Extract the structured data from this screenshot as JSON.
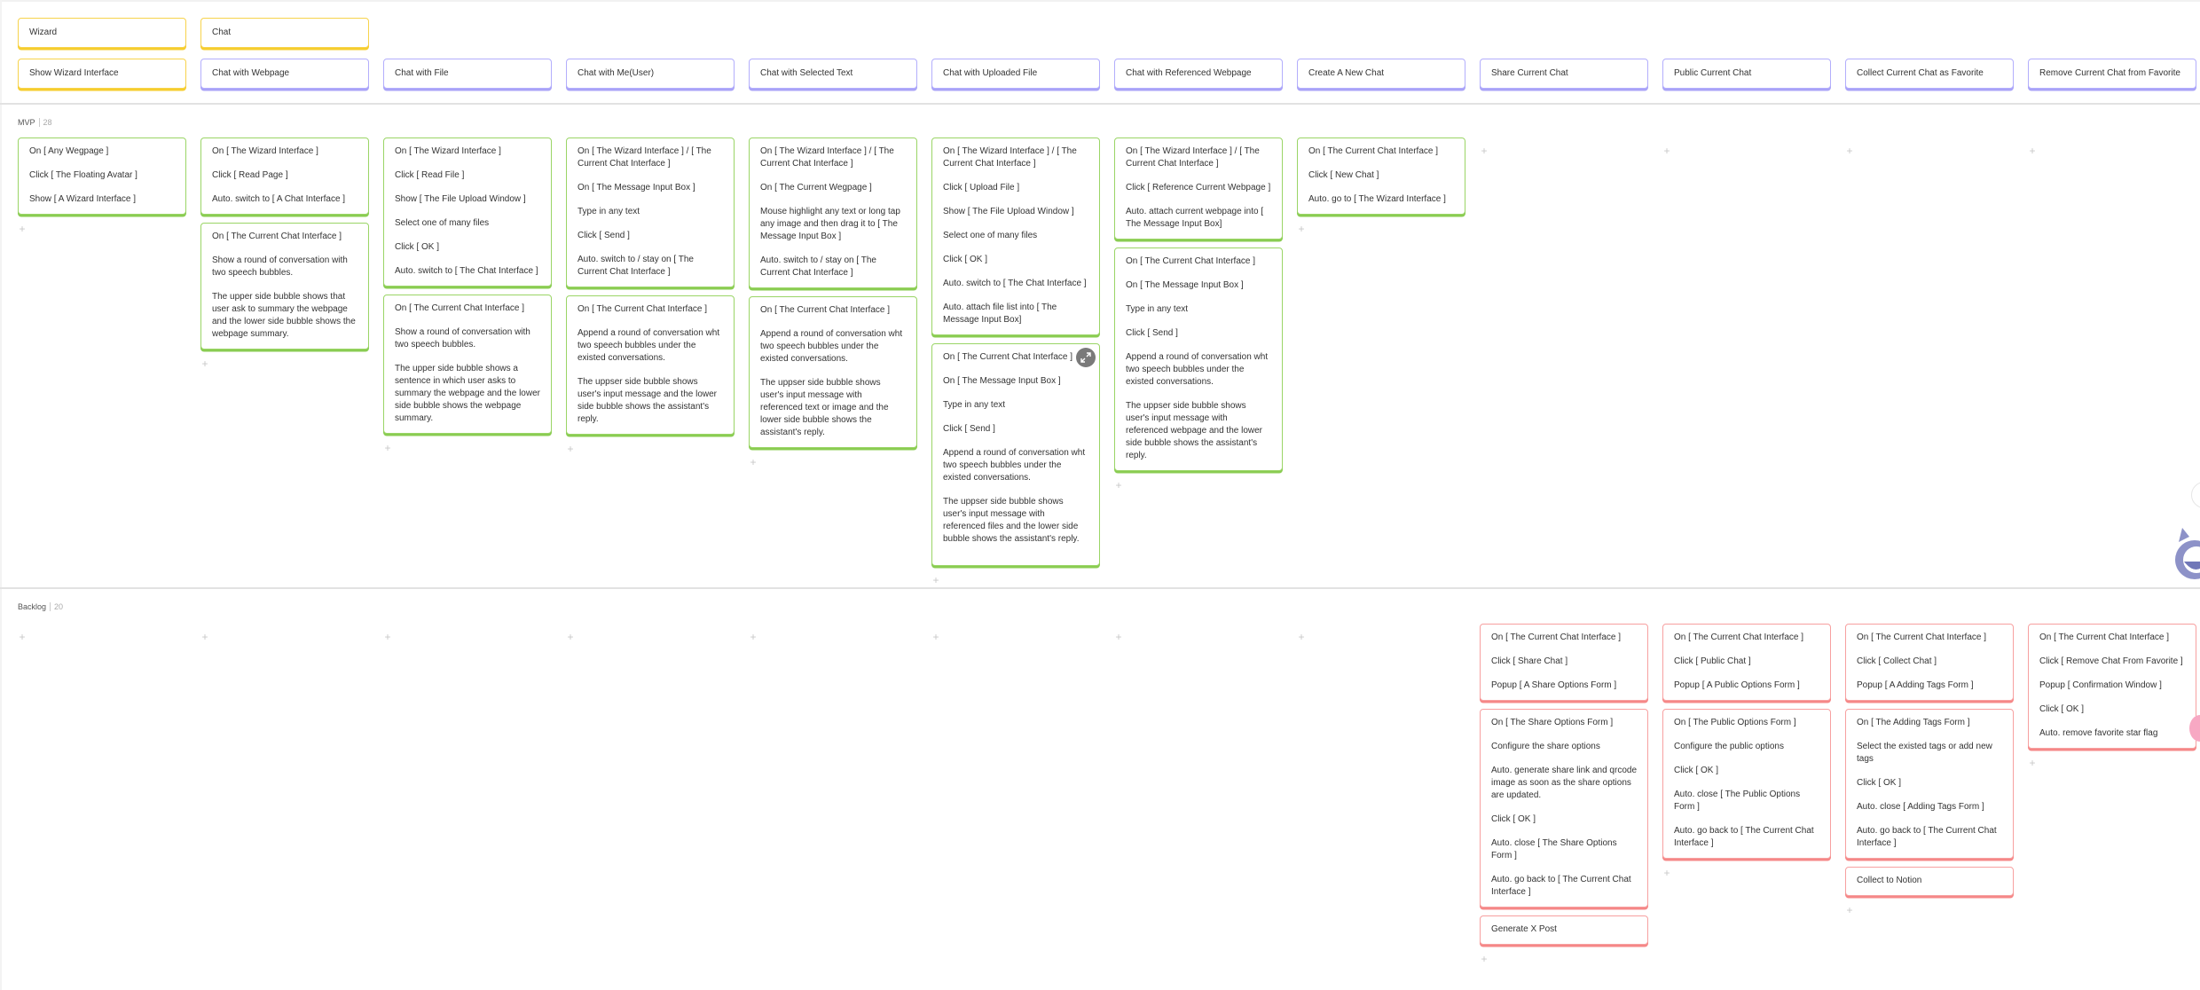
{
  "activities": [
    {
      "label": "Wizard"
    },
    {
      "label": "Chat"
    }
  ],
  "features": [
    {
      "label": "Show Wizard Interface"
    },
    {
      "label": "Chat with Webpage"
    },
    {
      "label": "Chat with File"
    },
    {
      "label": "Chat with Me(User)"
    },
    {
      "label": "Chat with Selected Text"
    },
    {
      "label": "Chat with Uploaded File"
    },
    {
      "label": "Chat with Referenced Webpage"
    },
    {
      "label": "Create A New Chat"
    },
    {
      "label": "Share Current Chat"
    },
    {
      "label": "Public Current Chat"
    },
    {
      "label": "Collect Current Chat as Favorite"
    },
    {
      "label": "Remove Current Chat from Favorite"
    }
  ],
  "releases": {
    "mvp": {
      "name": "MVP",
      "count": "28",
      "columns": [
        [
          [
            "On [ Any Wegpage ]",
            "Click [ The Floating Avatar ]",
            "Show [ A Wizard Interface ]"
          ]
        ],
        [
          [
            "On [ The Wizard Interface ]",
            "Click [ Read Page ]",
            "Auto. switch to [ A Chat Interface ]"
          ],
          [
            "On [ The Current Chat Interface ]",
            "Show a round of conversation with two speech bubbles.",
            "The upper side bubble shows that user ask to summary the webpage and the lower side bubble shows the webpage summary."
          ]
        ],
        [
          [
            "On [ The Wizard Interface ]",
            "Click [ Read File ]",
            "Show [ The File Upload Window ]",
            "Select one of many files",
            "Click [ OK ]",
            "Auto. switch to [ The Chat Interface ]"
          ],
          [
            "On [ The Current Chat Interface ]",
            "Show a round of conversation with two speech bubbles.",
            "The upper side bubble shows a sentence in which user asks to summary the webpage and the lower side bubble shows the webpage summary."
          ]
        ],
        [
          [
            "On [ The Wizard Interface ] / [ The Current Chat Interface ]",
            "On [ The Message Input Box ]",
            "Type in any text",
            "Click [ Send ]",
            "Auto. switch to / stay on [ The Current Chat Interface ]"
          ],
          [
            "On [ The Current Chat Interface ]",
            "Append a round of conversation wht two speech bubbles under the existed conversations.",
            "The uppser side bubble shows user's input message and the lower side bubble shows the assistant's reply."
          ]
        ],
        [
          [
            "On [ The Wizard Interface ] / [ The Current Chat Interface ]",
            "On [ The Current Wegpage ]",
            "Mouse highlight any text or long tap any image and then drag it to [ The Message Input Box ]",
            "Auto. switch to / stay on [ The Current Chat Interface ]"
          ],
          [
            "On [ The Current Chat Interface ]",
            "Append a round of conversation wht two speech bubbles under the existed conversations.",
            "The uppser side bubble shows user's input message with referenced text or image and the lower side bubble shows the assistant's reply."
          ]
        ],
        [
          [
            "On [ The Wizard Interface ] / [ The Current Chat Interface ]",
            "Click [ Upload File ]",
            "Show [ The File Upload Window ]",
            "Select one of many files",
            "Click [ OK ]",
            "Auto. switch to [ The Chat Interface ]",
            "Auto. attach file list into [ The Message Input Box]"
          ],
          [
            "On [ The Current Chat Interface ]",
            "On [ The Message Input Box ]",
            "Type in any text",
            "Click [ Send ]",
            "Append a round of conversation wht two speech bubbles under the existed conversations.",
            "The uppser side bubble shows user's input message with referenced files and the lower side bubble shows the assistant's reply."
          ]
        ],
        [
          [
            "On [ The Wizard Interface ] / [ The Current Chat Interface ]",
            "Click [ Reference Current Webpage ]",
            "Auto. attach current webpage into [ The Message Input Box]"
          ],
          [
            "On [ The Current Chat Interface ]",
            "On [ The Message Input Box ]",
            "Type in any text",
            "Click [ Send ]",
            "Append a round of conversation wht two speech bubbles under the existed conversations.",
            "The uppser side bubble shows user's input message with referenced webpage and the lower side bubble shows the assistant's reply."
          ]
        ],
        [
          [
            "On [ The Current Chat Interface ]",
            "Click [ New Chat ]",
            "Auto. go to [ The Wizard Interface ]"
          ]
        ],
        [],
        [],
        [],
        []
      ]
    },
    "backlog": {
      "name": "Backlog",
      "count": "20",
      "columns": [
        [],
        [],
        [],
        [],
        [],
        [],
        [],
        [],
        [
          [
            "On [ The Current Chat Interface ]",
            "Click [ Share Chat ]",
            "Popup [ A Share Options Form ]"
          ],
          [
            "On [ The Share Options Form ]",
            "Configure the share options",
            "Auto. generate share link and qrcode image as soon as the share options are updated.",
            "Click [ OK ]",
            "Auto. close [ The Share Options Form ]",
            "Auto. go back to [ The Current Chat Interface ]"
          ],
          [
            "Generate X Post"
          ]
        ],
        [
          [
            "On [ The Current Chat Interface ]",
            "Click [ Public Chat ]",
            "Popup [ A Public Options Form ]"
          ],
          [
            "On [ The Public Options Form ]",
            "Configure the public options",
            "Click [ OK ]",
            "Auto. close [ The Public Options Form ]",
            "Auto. go back to [ The Current Chat Interface ]"
          ]
        ],
        [
          [
            "On [ The Current Chat Interface ]",
            "Click [ Collect Chat ]",
            "Popup [ A Adding Tags Form ]"
          ],
          [
            "On [ The Adding Tags Form ]",
            "Select the existed tags or add new tags",
            "Click [ OK ]",
            "Auto. close [ Adding Tags Form ]",
            "Auto. go back to [ The Current Chat Interface ]"
          ],
          [
            "Collect to Notion"
          ]
        ],
        [
          [
            "On [ The Current Chat Interface ]",
            "Click [ Remove Chat From Favorite ]",
            "Popup [ Confirmation Window ]",
            "Click [ OK ]",
            "Auto. remove favorite star flag"
          ]
        ]
      ]
    }
  },
  "icons": {
    "add": "+",
    "expand": "expand-icon",
    "assistant_avatar": "cat-avatar-icon"
  },
  "colors": {
    "activity": "#f7d34b",
    "feature": "#b3aefc",
    "mvp_story": "#9ad566",
    "backlog_story": "#f7a0a0"
  }
}
